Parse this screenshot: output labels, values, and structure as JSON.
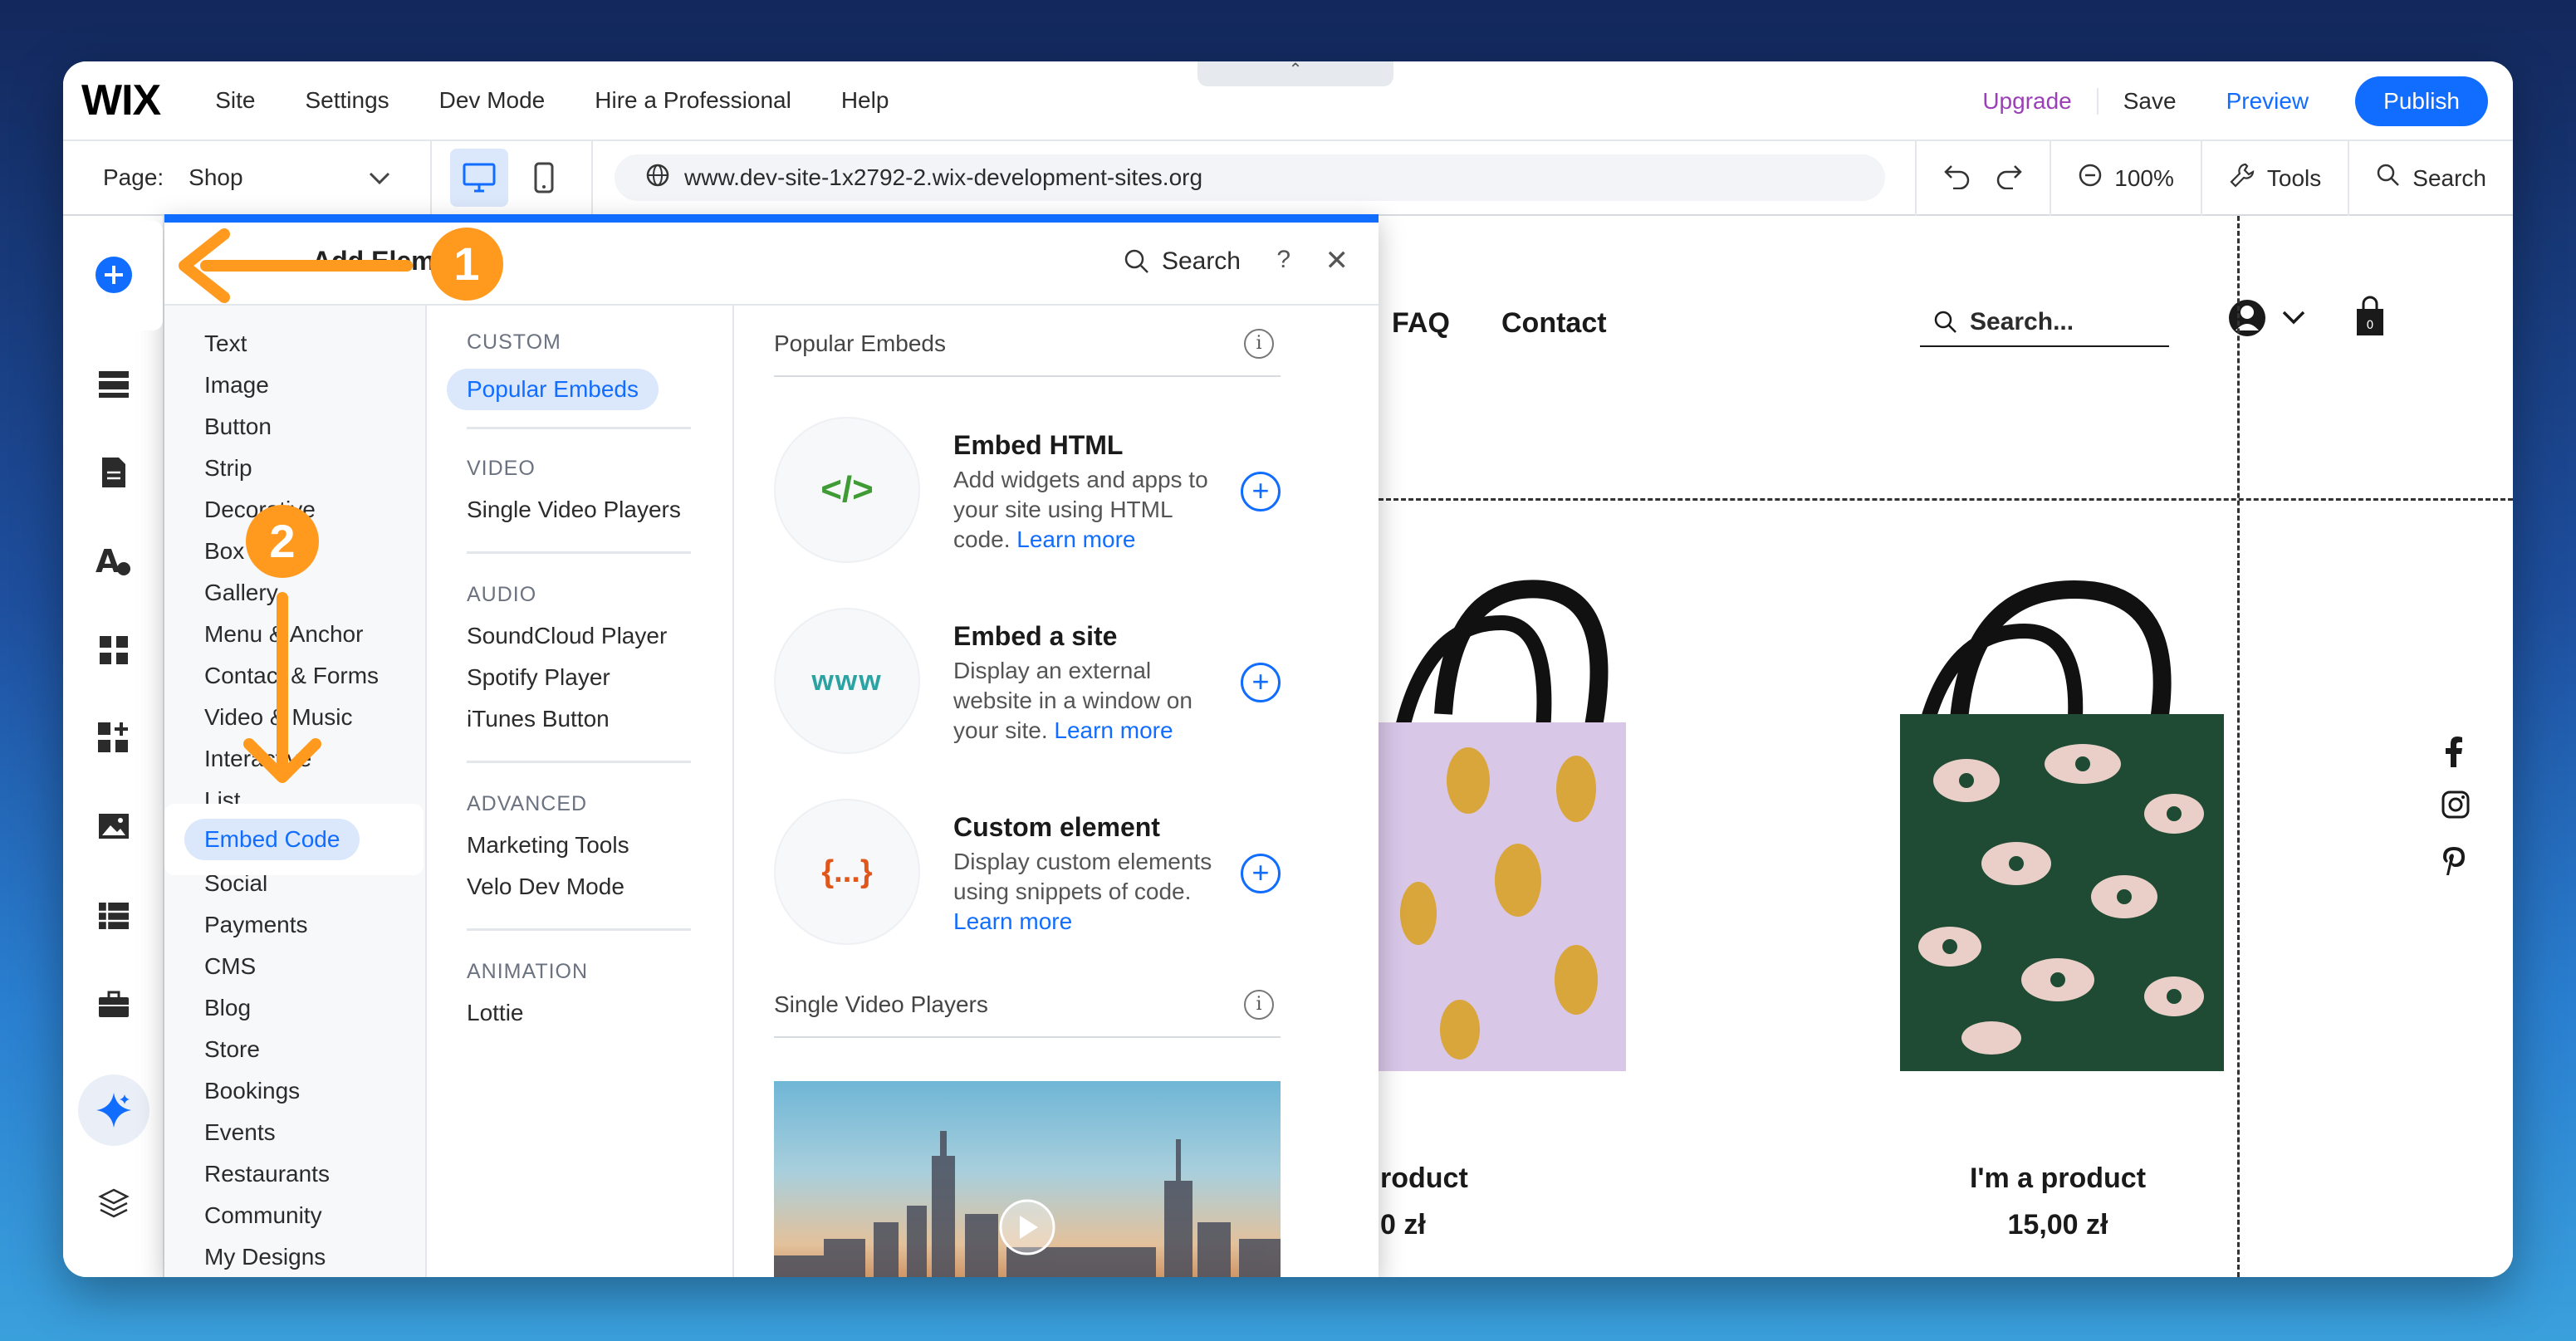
{
  "topbar": {
    "logo": "WIX",
    "menu": [
      "Site",
      "Settings",
      "Dev Mode",
      "Hire a Professional",
      "Help"
    ],
    "collapse_glyph": "⌃",
    "upgrade": "Upgrade",
    "save": "Save",
    "preview": "Preview",
    "publish": "Publish"
  },
  "toolbar": {
    "page_label": "Page:",
    "page_value": "Shop",
    "url": "www.dev-site-1x2792-2.wix-development-sites.org",
    "zoom": "100%",
    "tools": "Tools",
    "search": "Search"
  },
  "site": {
    "nav": [
      "FAQ",
      "Contact"
    ],
    "search_placeholder": "Search...",
    "cart_count": "0",
    "products": [
      {
        "title": "roduct",
        "price": "0 zł"
      },
      {
        "title": "I'm a product",
        "price": "15,00 zł"
      }
    ]
  },
  "panel": {
    "title": "Add Elements",
    "search": "Search",
    "help": "?",
    "close": "✕",
    "categories": [
      "Text",
      "Image",
      "Button",
      "Strip",
      "Decorative",
      "Box",
      "Gallery",
      "Menu & Anchor",
      "Contact & Forms",
      "Video & Music",
      "Interactive",
      "List",
      "Embed Code",
      "Social",
      "Payments",
      "CMS",
      "Blog",
      "Store",
      "Bookings",
      "Events",
      "Restaurants",
      "Community",
      "My Designs"
    ],
    "selected_category": "Embed Code",
    "subcategories": [
      {
        "head": "CUSTOM",
        "items": [
          "Popular Embeds"
        ]
      },
      {
        "head": "VIDEO",
        "items": [
          "Single Video Players"
        ]
      },
      {
        "head": "AUDIO",
        "items": [
          "SoundCloud Player",
          "Spotify Player",
          "iTunes Button"
        ]
      },
      {
        "head": "ADVANCED",
        "items": [
          "Marketing Tools",
          "Velo Dev Mode"
        ]
      },
      {
        "head": "ANIMATION",
        "items": [
          "Lottie"
        ]
      }
    ],
    "selected_subcategory": "Popular Embeds",
    "section_popular": "Popular Embeds",
    "section_video": "Single Video Players",
    "embeds": [
      {
        "title": "Embed HTML",
        "desc": "Add widgets and apps to your site using HTML code.",
        "link": "Learn more",
        "icon": "</>",
        "icon_color": "#3f9c35"
      },
      {
        "title": "Embed a site",
        "desc": "Display an external website in a window on your site.",
        "link": "Learn more",
        "icon": "www",
        "icon_color": "#2ba3a3"
      },
      {
        "title": "Custom element",
        "desc": "Display custom elements using snippets of code.",
        "link": "Learn more",
        "icon": "{...}",
        "icon_color": "#e0561b"
      }
    ]
  },
  "annotations": {
    "step1": "1",
    "step2": "2",
    "color": "#ff9a1f"
  },
  "colors": {
    "accent": "#116dff",
    "upgrade": "#9b3fb8"
  }
}
